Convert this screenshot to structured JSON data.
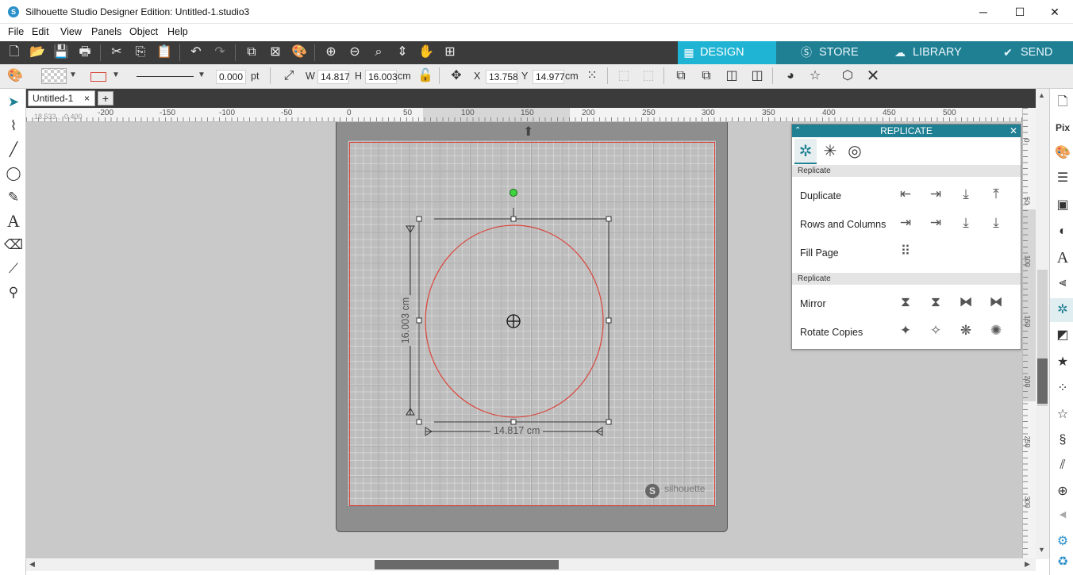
{
  "window": {
    "title": "Silhouette Studio Designer Edition: Untitled-1.studio3",
    "minimize_label": "─",
    "maximize_label": "☐",
    "close_label": "✕"
  },
  "menu": {
    "file": "File",
    "edit": "Edit",
    "view": "View",
    "panels": "Panels",
    "object": "Object",
    "help": "Help"
  },
  "nav_tabs": {
    "design": "DESIGN",
    "store": "STORE",
    "library": "LIBRARY",
    "send": "SEND",
    "active_color": "#1fb4d3",
    "inactive_color": "#1f7f93"
  },
  "properties": {
    "line_width": "0.000",
    "line_unit": "pt",
    "w_label": "W",
    "w_value": "14.817",
    "h_label": "H",
    "h_value": "16.003",
    "size_unit": "cm",
    "x_label": "X",
    "x_value": "13.758",
    "y_label": "Y",
    "y_value": "14.977",
    "pos_unit": "cm"
  },
  "document_tab": {
    "name": "Untitled-1",
    "close": "×",
    "add": "+"
  },
  "ruler": {
    "cursor_readout": "18.533 , -0.400",
    "h_ticks": [
      "-200",
      "-150",
      "-100",
      "-50",
      "0",
      "50",
      "100",
      "150",
      "200",
      "250",
      "300",
      "350",
      "400",
      "450",
      "500"
    ],
    "v_ticks": [
      "0",
      "50",
      "100",
      "150",
      "200",
      "250",
      "300"
    ]
  },
  "canvas": {
    "width_dimension": "14.817 cm",
    "height_dimension": "16.003 cm",
    "watermark": "silhouette",
    "shape_stroke": "#d9453b"
  },
  "replicate_panel": {
    "title": "REPLICATE",
    "section1": "Replicate",
    "section2": "Replicate",
    "duplicate": "Duplicate",
    "rows_columns": "Rows and Columns",
    "fill_page": "Fill Page",
    "mirror": "Mirror",
    "rotate_copies": "Rotate Copies"
  },
  "colors": {
    "toolbar_dark": "#3b3b3b",
    "accent": "#1fb4d3",
    "panel_header": "#1f7f93",
    "selection_handle": "#3fd43f"
  }
}
